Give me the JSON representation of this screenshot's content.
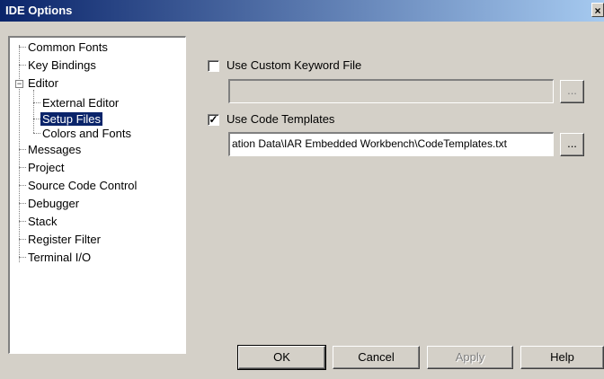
{
  "window": {
    "title": "IDE Options",
    "close_glyph": "×"
  },
  "tree": {
    "items": [
      {
        "label": "Common Fonts"
      },
      {
        "label": "Key Bindings"
      },
      {
        "label": "Editor",
        "expander": "−"
      },
      {
        "label": "External Editor"
      },
      {
        "label": "Setup Files",
        "selected": true
      },
      {
        "label": "Colors and Fonts"
      },
      {
        "label": "Messages"
      },
      {
        "label": "Project"
      },
      {
        "label": "Source Code Control"
      },
      {
        "label": "Debugger"
      },
      {
        "label": "Stack"
      },
      {
        "label": "Register Filter"
      },
      {
        "label": "Terminal I/O"
      }
    ]
  },
  "settings": {
    "custom_keyword": {
      "label": "Use Custom Keyword File",
      "checked": false,
      "check_glyph": "",
      "path": "",
      "browse_label": "..."
    },
    "code_templates": {
      "label": "Use Code Templates",
      "checked": true,
      "check_glyph": "✓",
      "path": "ation Data\\IAR Embedded Workbench\\CodeTemplates.txt",
      "browse_label": "..."
    }
  },
  "buttons": {
    "ok": "OK",
    "cancel": "Cancel",
    "apply": "Apply",
    "help": "Help"
  },
  "colors": {
    "titlebar_start": "#0a246a",
    "titlebar_end": "#a6caf0",
    "dialog_bg": "#d4d0c8",
    "selection": "#0a246a"
  }
}
